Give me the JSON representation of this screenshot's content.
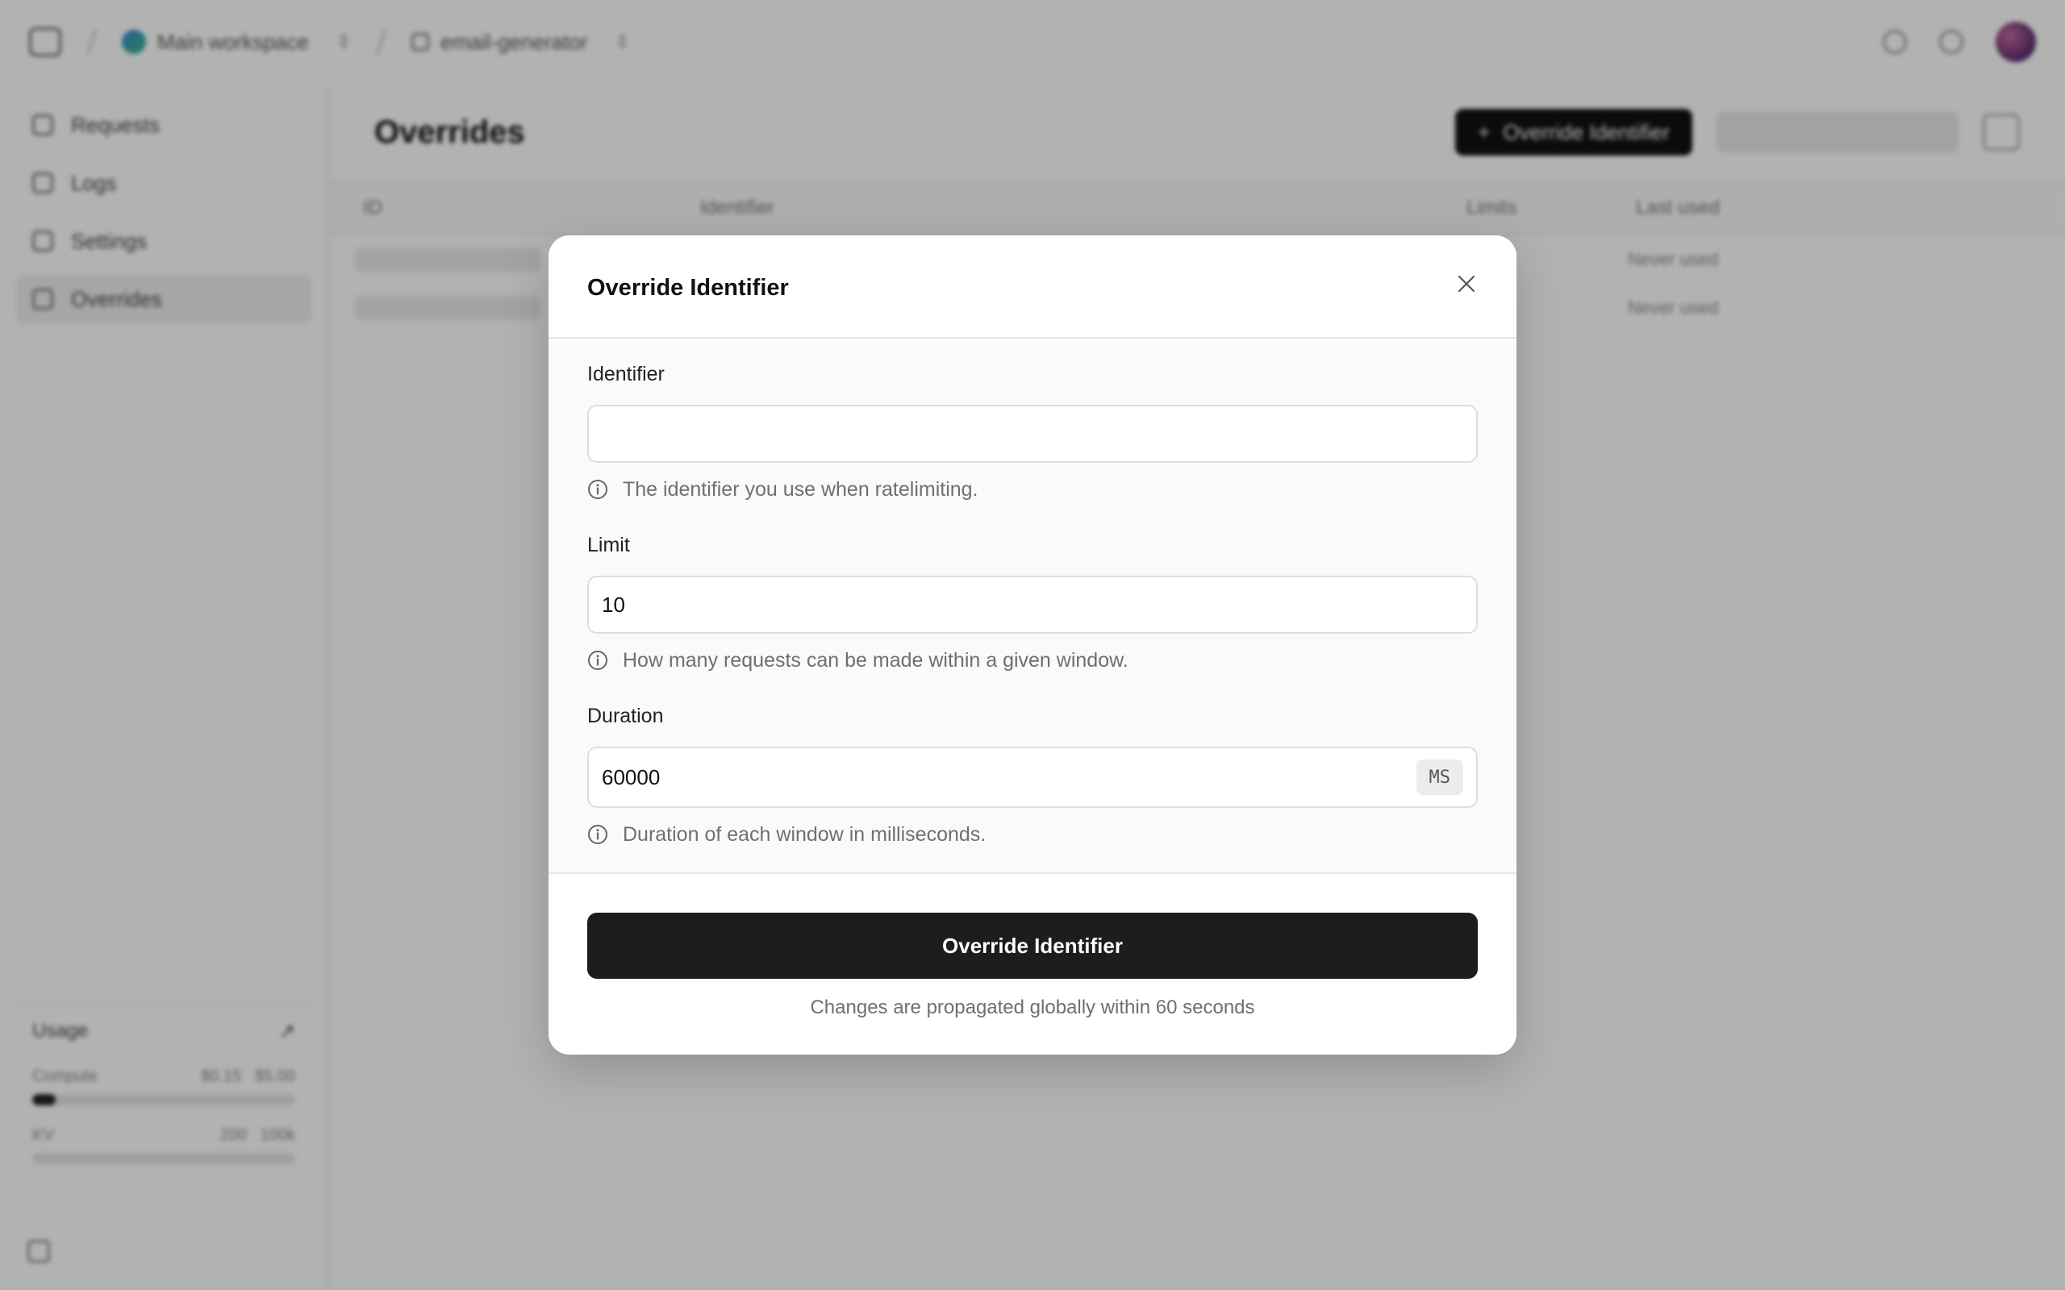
{
  "topbar": {
    "workspace": "Main workspace",
    "project": "email-generator"
  },
  "sidebar": {
    "items": [
      {
        "label": "Requests"
      },
      {
        "label": "Logs"
      },
      {
        "label": "Settings"
      },
      {
        "label": "Overrides"
      }
    ],
    "usage": {
      "title": "Usage",
      "rows": [
        {
          "label": "Compute",
          "value": "$0.15",
          "limit": "$5.00",
          "fill": 0.09
        },
        {
          "label": "KV",
          "value": "200",
          "limit": "100k",
          "fill": 0.0
        }
      ]
    }
  },
  "page": {
    "title": "Overrides",
    "primary_button": "Override Identifier"
  },
  "table": {
    "headers": [
      "ID",
      "Identifier",
      "Limits",
      "Last used"
    ],
    "rows": [
      {
        "last_used": "Never used"
      },
      {
        "last_used": "Never used"
      }
    ]
  },
  "modal": {
    "title": "Override Identifier",
    "identifier": {
      "label": "Identifier",
      "value": "",
      "hint": "The identifier you use when ratelimiting."
    },
    "limit": {
      "label": "Limit",
      "value": "10",
      "hint": "How many requests can be made within a given window."
    },
    "duration": {
      "label": "Duration",
      "value": "60000",
      "unit": "MS",
      "hint": "Duration of each window in milliseconds."
    },
    "submit_label": "Override Identifier",
    "footer_note": "Changes are propagated globally within 60 seconds"
  },
  "icons": {
    "close": "close-icon",
    "info": "info-icon"
  },
  "colors": {
    "primary_button": "#1d1d1d",
    "overlay": "rgba(0,0,0,0.30)"
  }
}
